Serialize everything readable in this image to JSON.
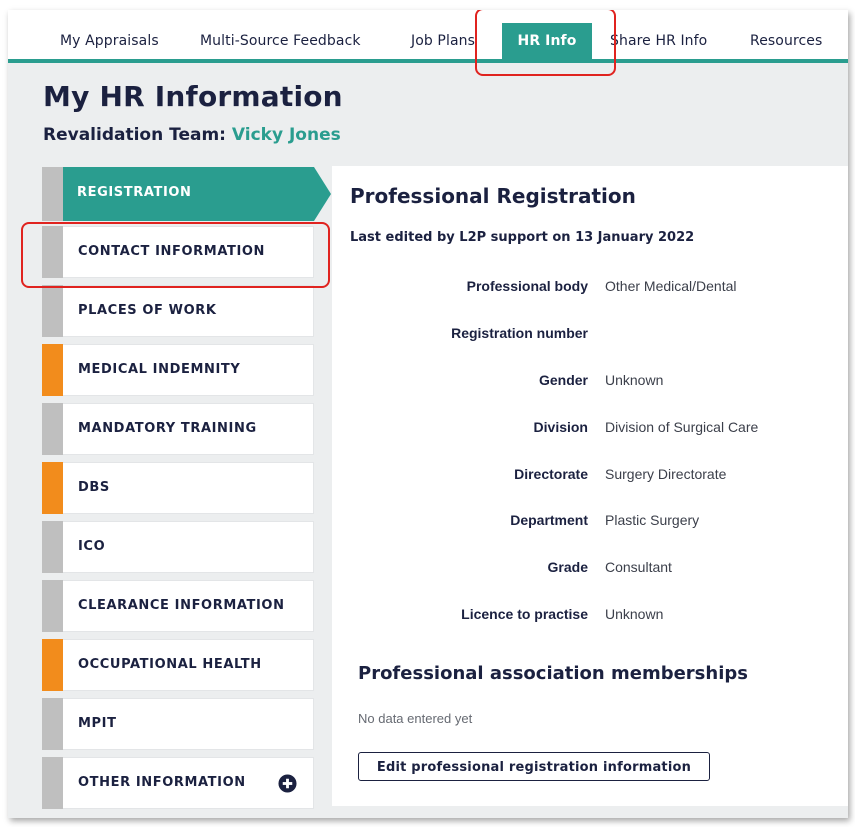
{
  "topnav": {
    "tabs": [
      {
        "label": "My Appraisals"
      },
      {
        "label": "Multi-Source Feedback"
      },
      {
        "label": "Job Plans"
      },
      {
        "label": "HR Info",
        "active": true
      },
      {
        "label": "Share HR Info"
      },
      {
        "label": "Resources"
      }
    ]
  },
  "header": {
    "title": "My HR Information",
    "team_label": "Revalidation Team:",
    "team_member": "Vicky Jones"
  },
  "sidebar": {
    "items": [
      {
        "label": "REGISTRATION",
        "status": "active"
      },
      {
        "label": "CONTACT INFORMATION",
        "status": "grey"
      },
      {
        "label": "PLACES OF WORK",
        "status": "grey"
      },
      {
        "label": "MEDICAL INDEMNITY",
        "status": "orange"
      },
      {
        "label": "MANDATORY TRAINING",
        "status": "grey"
      },
      {
        "label": "DBS",
        "status": "orange"
      },
      {
        "label": "ICO",
        "status": "grey"
      },
      {
        "label": "CLEARANCE INFORMATION",
        "status": "grey"
      },
      {
        "label": "OCCUPATIONAL HEALTH",
        "status": "orange"
      },
      {
        "label": "MPIT",
        "status": "grey"
      },
      {
        "label": "OTHER INFORMATION",
        "status": "grey",
        "icon": "plus-circle-icon"
      }
    ]
  },
  "main": {
    "title": "Professional Registration",
    "last_edited": "Last edited by L2P support on 13 January 2022",
    "fields": [
      {
        "label": "Professional body",
        "value": "Other Medical/Dental"
      },
      {
        "label": "Registration number",
        "value": ""
      },
      {
        "label": "Gender",
        "value": "Unknown"
      },
      {
        "label": "Division",
        "value": "Division of Surgical Care"
      },
      {
        "label": "Directorate",
        "value": "Surgery Directorate"
      },
      {
        "label": "Department",
        "value": "Plastic Surgery"
      },
      {
        "label": "Grade",
        "value": "Consultant"
      },
      {
        "label": "Licence to practise",
        "value": "Unknown"
      }
    ],
    "memberships_title": "Professional association memberships",
    "memberships_empty": "No data entered yet",
    "edit_button": "Edit professional registration information"
  },
  "colors": {
    "accent_teal": "#2a9d8f",
    "navy_text": "#1b2140",
    "status_orange": "#f28c1c",
    "status_grey": "#bfbfbf",
    "annotation_red": "#e0231f"
  }
}
